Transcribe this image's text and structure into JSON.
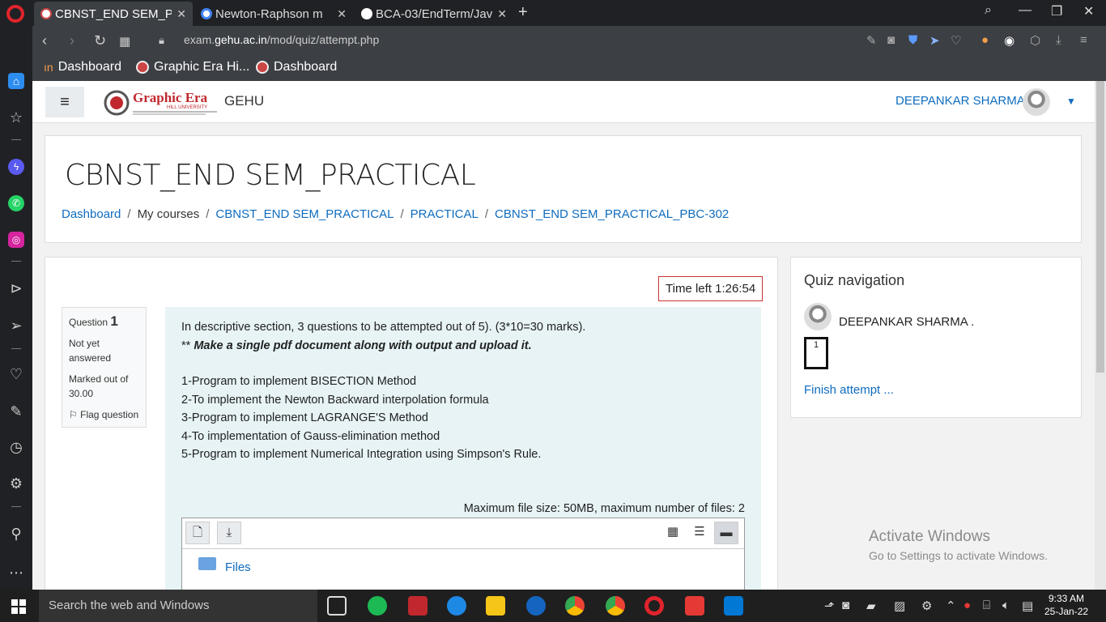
{
  "browser": {
    "tabs": [
      {
        "title": "CBNST_END SEM_PR",
        "active": true
      },
      {
        "title": "Newton-Raphson m",
        "active": false
      },
      {
        "title": "BCA-03/EndTerm/Jav",
        "active": false
      }
    ],
    "url_prefix": "exam.",
    "url_domain": "gehu.ac.in",
    "url_path": "/mod/quiz/attempt.php",
    "bookmarks": [
      "Dashboard",
      "Graphic Era Hi...",
      "Dashboard"
    ]
  },
  "navbar": {
    "site_name": "GEHU",
    "logo_text": "Graphic Era",
    "logo_subtext": "HILL UNIVERSITY",
    "user_name": "DEEPANKAR SHARMA ."
  },
  "header": {
    "course_title": "CBNST_END SEM_PRACTICAL",
    "breadcrumb": [
      "Dashboard",
      "My courses",
      "CBNST_END SEM_PRACTICAL",
      "PRACTICAL",
      "CBNST_END SEM_PRACTICAL_PBC-302"
    ],
    "breadcrumb_sep": "/"
  },
  "quiz": {
    "time_left": "Time left 1:26:54",
    "question_label": "Question",
    "question_number": "1",
    "status": "Not yet answered",
    "marks": "Marked out of 30.00",
    "flag": "Flag question",
    "intro_line": "In descriptive section, 3 questions to be attempted out of 5). (3*10=30 marks).",
    "instruction_prefix": "**",
    "instruction": "Make a single pdf document along with output and upload it.",
    "items": [
      "1-Program to implement BISECTION Method",
      "2-To implement the Newton Backward interpolation formula",
      "3-Program to implement LAGRANGE'S Method",
      "4-To implementation of Gauss-elimination method",
      "5-Program to implement Numerical Integration using Simpson's Rule."
    ],
    "max_file_info": "Maximum file size: 50MB, maximum number of files: 2",
    "folder_label": "Files"
  },
  "quiz_nav": {
    "title": "Quiz navigation",
    "user": "DEEPANKAR SHARMA .",
    "question_button": "1",
    "finish": "Finish attempt ..."
  },
  "watermark": {
    "line1": "Activate Windows",
    "line2": "Go to Settings to activate Windows."
  },
  "taskbar": {
    "search_placeholder": "Search the web and Windows",
    "time": "9:33 AM",
    "date": "25-Jan-22"
  }
}
